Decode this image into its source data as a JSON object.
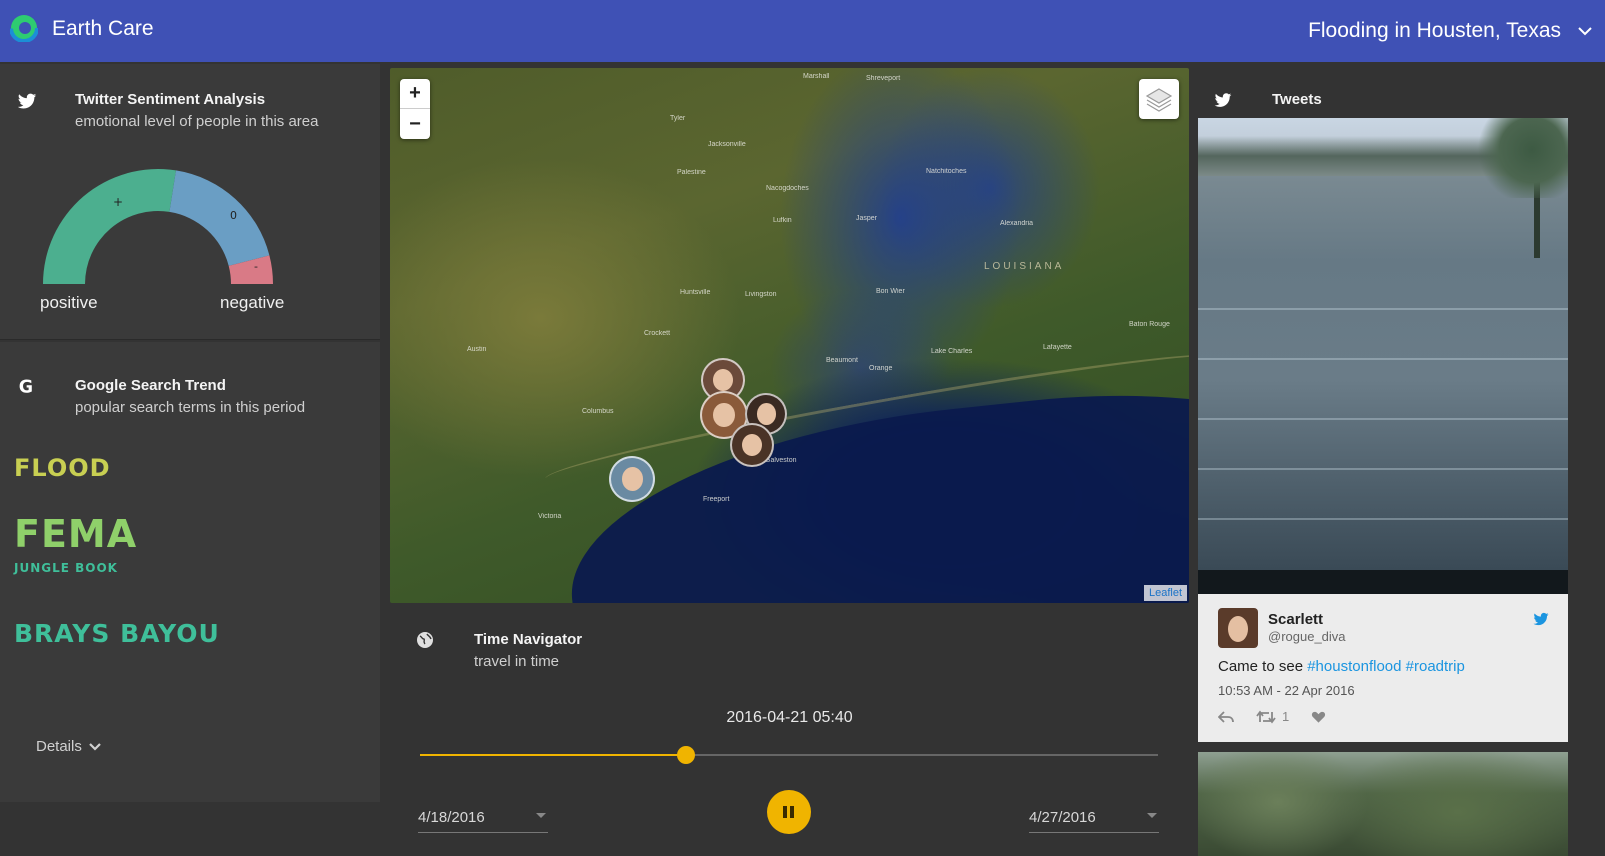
{
  "app": {
    "title": "Earth Care",
    "event": "Flooding in Housten, Texas"
  },
  "sentiment": {
    "title": "Twitter Sentiment Analysis",
    "subtitle": "emotional level of people in this area",
    "label_positive": "positive",
    "label_negative": "negative",
    "plus_sign": "+",
    "neutral_sign": "0",
    "minus_sign": "-",
    "share_positive": 0.55,
    "share_neutral": 0.37,
    "share_negative": 0.08,
    "colors": {
      "positive": "#4caf8f",
      "neutral": "#6a9ec4",
      "negative": "#d97a86"
    }
  },
  "search_trend": {
    "title": "Google Search Trend",
    "subtitle": "popular search terms in this period",
    "terms": [
      {
        "text": "FLOOD",
        "color": "#c8cf52"
      },
      {
        "text": "FEMA",
        "color": "#8fd06a"
      },
      {
        "text": "JUNGLE BOOK",
        "color": "#3fbf9a"
      },
      {
        "text": "BRAYS BAYOU",
        "color": "#3fbf9a"
      }
    ],
    "details_label": "Details"
  },
  "map": {
    "zoom_in": "+",
    "zoom_out": "−",
    "attribution": "Leaflet",
    "region_label": "LOUISIANA",
    "places": [
      "Shreveport",
      "Marshall",
      "Jacksonville",
      "Nacogdoches",
      "Lufkin",
      "Huntsville",
      "Livingston",
      "Beaumont",
      "Orange",
      "Lake Charles",
      "Lafayette",
      "Baton Rouge",
      "Austin",
      "Columbus",
      "Freeport",
      "Galveston",
      "Victoria",
      "Alexandria",
      "Natchitoches",
      "Jasper",
      "Bon Wier",
      "Palestine",
      "Tyler",
      "Crockett"
    ]
  },
  "time_navigator": {
    "title": "Time Navigator",
    "subtitle": "travel in time",
    "current": "2016-04-21 05:40",
    "progress": 0.36,
    "start_date": "4/18/2016",
    "end_date": "4/27/2016",
    "accent": "#f0b400"
  },
  "tweets": {
    "title": "Tweets",
    "card": {
      "name": "Scarlett",
      "handle": "@rogue_diva",
      "text_plain": "Came to see ",
      "tag1": "#houstonflood",
      "tag2": "#roadtrip",
      "time": "10:53 AM - 22 Apr 2016",
      "retweets": "1"
    }
  }
}
